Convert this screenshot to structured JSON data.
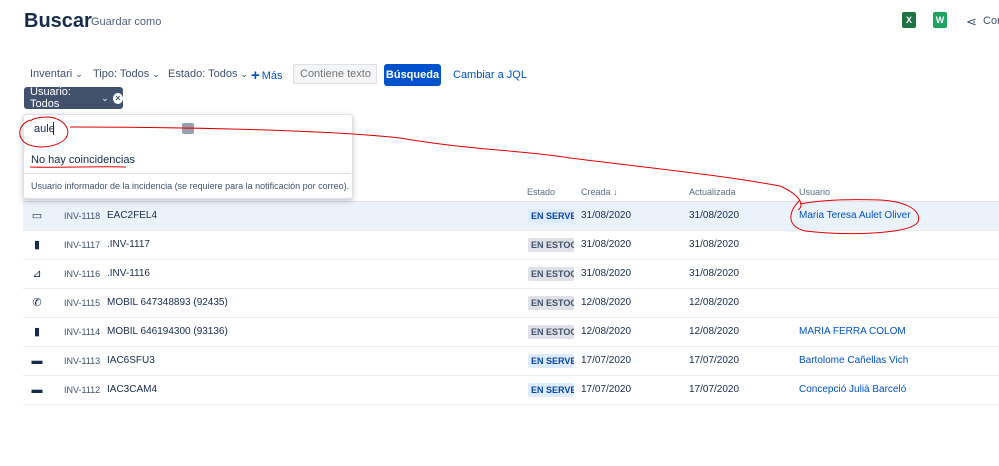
{
  "header": {
    "title": "Buscar",
    "save_as": "Guardar como",
    "excel_icon": "X",
    "sheet_icon": "W",
    "share_label": "Cor"
  },
  "filters": {
    "inventari": "Inventari",
    "tipo": "Tipo: Todos",
    "estado": "Estado: Todos",
    "more": "Más",
    "text_placeholder": "Contiene texto",
    "search_button": "Búsqueda",
    "jql_link": "Cambiar a JQL",
    "user_chip": "Usuario: Todos",
    "chip_close": "×"
  },
  "user_popup": {
    "query": "aule",
    "no_matches": "No hay coincidencias",
    "hint": "Usuario informador de la incidencia (se requiere para la notificación por correo)."
  },
  "table": {
    "columns": {
      "estado": "Estado",
      "creada": "Creada",
      "actualizada": "Actualizada",
      "usuario": "Usuario"
    },
    "rows": [
      {
        "icon": "monitor-icon",
        "glyph": "▭",
        "key": "INV-1118",
        "summary": "EAC2FEL4",
        "status": "EN SERVEI",
        "status_color": "blue",
        "created": "31/08/2020",
        "updated": "31/08/2020",
        "user": "Maria Teresa Aulet Oliver"
      },
      {
        "icon": "mobile-icon",
        "glyph": "▮",
        "key": "INV-1117",
        "summary": ".INV-1117",
        "status": "EN ESTOC",
        "status_color": "grey",
        "created": "31/08/2020",
        "updated": "31/08/2020",
        "user": ""
      },
      {
        "icon": "laptop-icon",
        "glyph": "⊿",
        "key": "INV-1116",
        "summary": ".INV-1116",
        "status": "EN ESTOC",
        "status_color": "grey",
        "created": "31/08/2020",
        "updated": "31/08/2020",
        "user": ""
      },
      {
        "icon": "phone-icon",
        "glyph": "✆",
        "key": "INV-1115",
        "summary": "MOBIL 647348893 (92435)",
        "status": "EN ESTOC",
        "status_color": "grey",
        "created": "12/08/2020",
        "updated": "12/08/2020",
        "user": ""
      },
      {
        "icon": "mobile-icon",
        "glyph": "▮",
        "key": "INV-1114",
        "summary": "MOBIL 646194300 (93136)",
        "status": "EN ESTOC",
        "status_color": "grey",
        "created": "12/08/2020",
        "updated": "12/08/2020",
        "user": "MARIA FERRA COLOM"
      },
      {
        "icon": "printer-icon",
        "glyph": "▬",
        "key": "INV-1113",
        "summary": "IAC6SFU3",
        "status": "EN SERVEI",
        "status_color": "blue",
        "created": "17/07/2020",
        "updated": "17/07/2020",
        "user": "Bartolome Cañellas Vich"
      },
      {
        "icon": "printer-icon",
        "glyph": "▬",
        "key": "INV-1112",
        "summary": "IAC3CAM4",
        "status": "EN SERVEI",
        "status_color": "blue",
        "created": "17/07/2020",
        "updated": "17/07/2020",
        "user": "Concepció Julià Barceló"
      }
    ]
  },
  "colors": {
    "primary": "#0052cc",
    "chip": "#42526e",
    "annotation": "#e00000",
    "excel": "#1f7244",
    "sheets": "#1fa463"
  }
}
